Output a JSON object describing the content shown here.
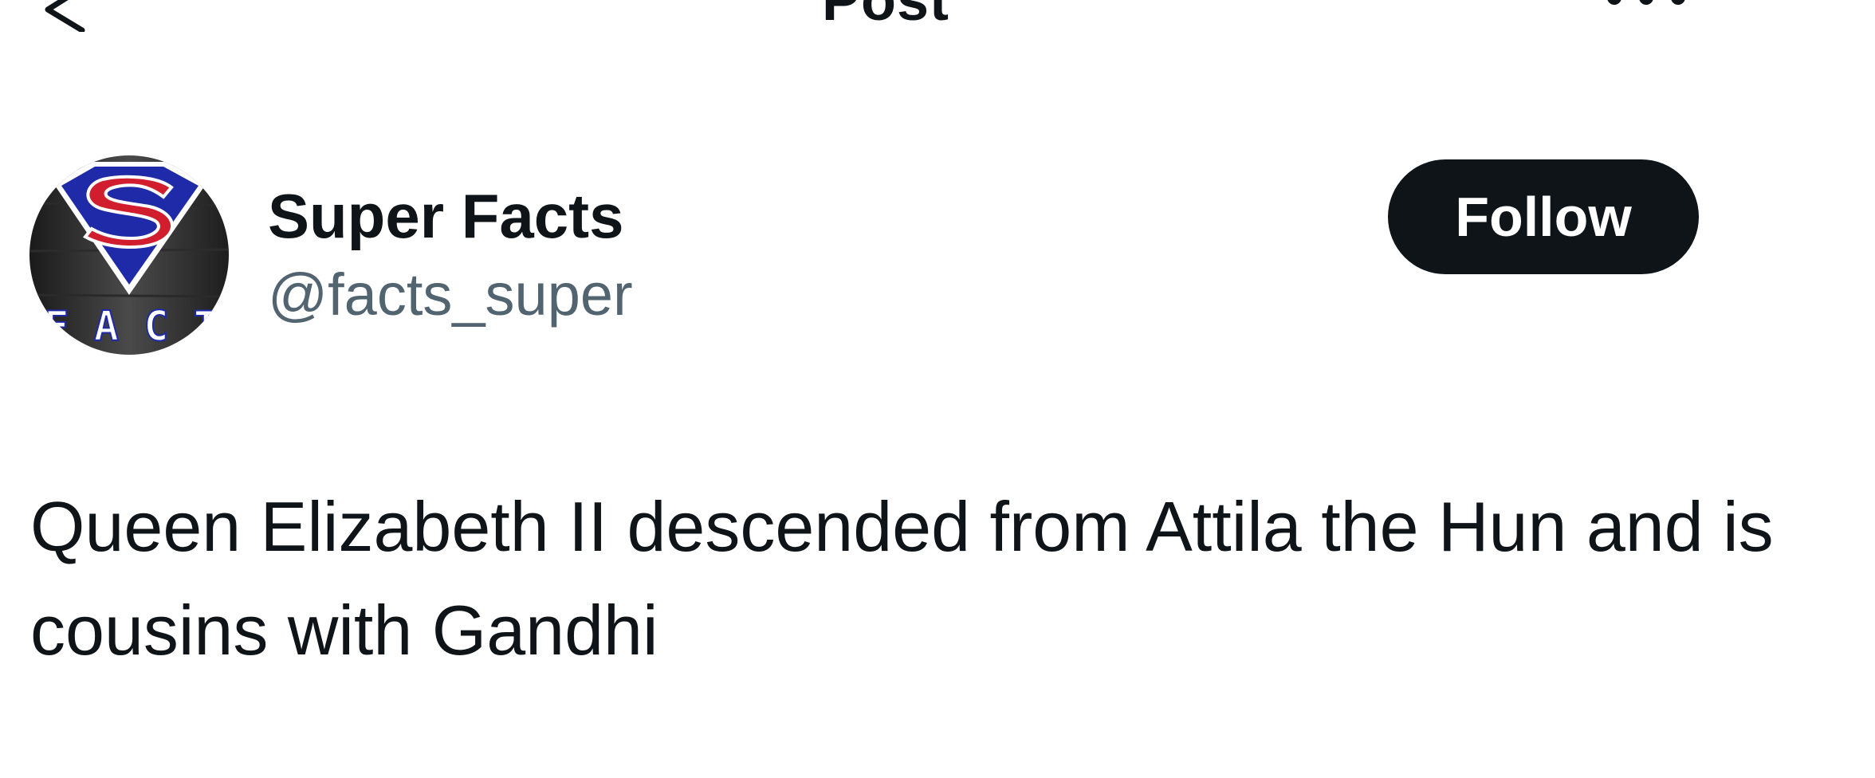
{
  "header": {
    "title": "Post",
    "back_icon": "back-arrow-icon",
    "more_icon": "more-options-icon"
  },
  "author": {
    "name": "Super Facts",
    "handle": "@facts_super",
    "avatar_text": "FACTS",
    "follow_label": "Follow"
  },
  "post": {
    "text": "Queen Elizabeth II descended from Attila the Hun and is cousins with Gandhi"
  },
  "colors": {
    "text_primary": "#0f1419",
    "text_secondary": "#536471",
    "button_bg": "#0f1419",
    "button_text": "#ffffff",
    "logo_blue": "#1f2aa8",
    "logo_red": "#d01e2e"
  }
}
